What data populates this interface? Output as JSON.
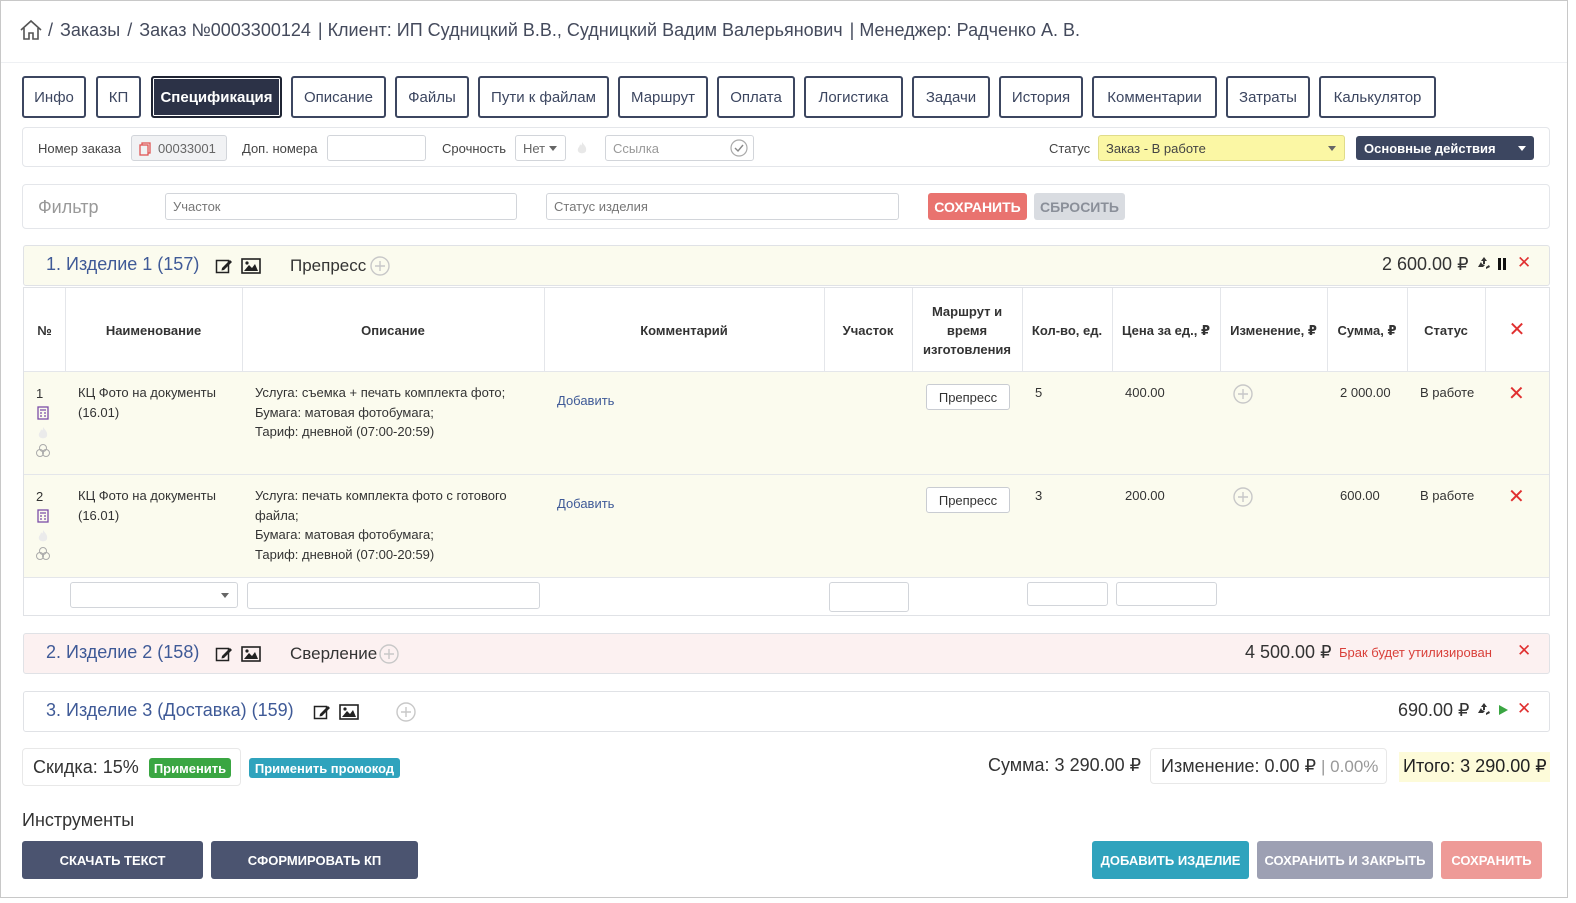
{
  "breadcrumb": {
    "sep": "/",
    "orders": "Заказы",
    "order": "Заказ №0003300124",
    "client": "| Клиент: ИП Судницкий В.В., Судницкий Вадим Валерьянович",
    "manager": "| Менеджер: Радченко А. В."
  },
  "tabs": [
    "Инфо",
    "КП",
    "Спецификация",
    "Описание",
    "Файлы",
    "Пути к файлам",
    "Маршрут",
    "Оплата",
    "Логистика",
    "Задачи",
    "История",
    "Комментарии",
    "Затраты",
    "Калькулятор"
  ],
  "info_bar": {
    "order_number_label": "Номер заказа",
    "order_number_value": "00033001",
    "extra_numbers_label": "Доп. номера",
    "extra_numbers_value": "",
    "urgency_label": "Срочность",
    "urgency_value": "Нет",
    "link_placeholder": "Ссылка",
    "status_label": "Статус",
    "status_value": "Заказ - В работе",
    "main_actions": "Основные действия"
  },
  "filter": {
    "title": "Фильтр",
    "section_placeholder": "Участок",
    "item_status_placeholder": "Статус изделия",
    "save": "СОХРАНИТЬ",
    "reset": "СБРОСИТЬ"
  },
  "products": [
    {
      "title": "1. Изделие 1 (157)",
      "stage": "Препресс",
      "sum": "2 600.00 ₽",
      "note": ""
    },
    {
      "title": "2. Изделие 2 (158)",
      "stage": "Сверление",
      "sum": "4 500.00 ₽",
      "note": "Брак будет утилизирован"
    },
    {
      "title": "3. Изделие 3 (Доставка) (159)",
      "stage": "",
      "sum": "690.00 ₽",
      "note": ""
    }
  ],
  "table": {
    "headers": {
      "num": "№",
      "name": "Наименование",
      "description": "Описание",
      "comment": "Комментарий",
      "section": "Участок",
      "route": "Маршрут и время изготовления",
      "qty": "Кол-во, ед.",
      "price": "Цена за ед., ₽",
      "change": "Изменение, ₽",
      "sum": "Сумма, ₽",
      "status": "Статус"
    },
    "rows": [
      {
        "num": "1",
        "name": "КЦ Фото на документы (16.01)",
        "description": [
          "Услуга: съемка + печать комплекта фото;",
          "Бумага: матовая фотобумага;",
          "Тариф: дневной (07:00-20:59)"
        ],
        "comment": "Добавить",
        "route": "Препресс",
        "qty": "5",
        "price": "400.00",
        "sum": "2 000.00",
        "status": "В работе"
      },
      {
        "num": "2",
        "name": "КЦ Фото на документы (16.01)",
        "description": [
          "Услуга: печать комплекта фото с готового файла;",
          "Бумага: матовая фотобумага;",
          "Тариф: дневной (07:00-20:59)"
        ],
        "comment": "Добавить",
        "route": "Препресс",
        "qty": "3",
        "price": "200.00",
        "sum": "600.00",
        "status": "В работе"
      }
    ]
  },
  "totals": {
    "discount": "Скидка: 15%",
    "apply": "Применить",
    "promo": "Применить промокод",
    "sum": "Сумма: 3 290.00 ₽",
    "change": "Изменение: 0.00 ₽",
    "change_pct": "| 0.00%",
    "total": "Итого: 3 290.00 ₽"
  },
  "tools": {
    "title": "Инструменты",
    "download_text": "СКАЧАТЬ ТЕКСТ",
    "make_kp": "СФОРМИРОВАТЬ КП",
    "add_item": "ДОБАВИТЬ ИЗДЕЛИЕ",
    "save_close": "СОХРАНИТЬ И ЗАКРЫТЬ",
    "save": "СОХРАНИТЬ"
  },
  "colors": {
    "dark": "#2c3247",
    "accent": "#3f5a97",
    "red": "#e85a5a",
    "teal": "#2fa3bd",
    "green": "#3aa642",
    "status_bg": "#fbf7a4"
  }
}
